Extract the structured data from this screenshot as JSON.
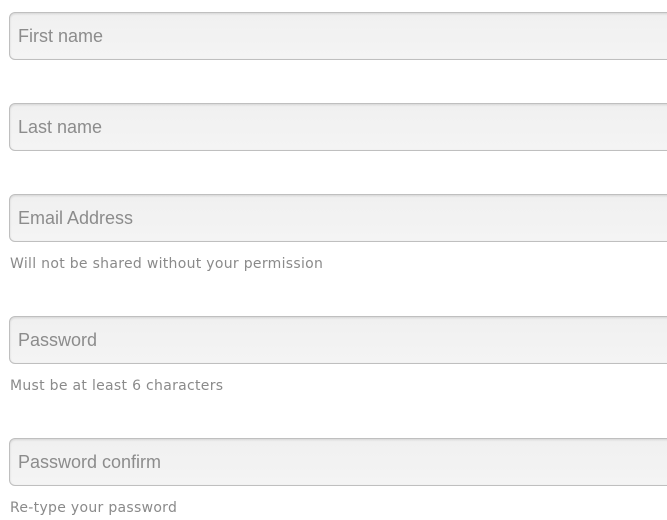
{
  "form": {
    "fields": [
      {
        "placeholder": "First name",
        "value": "",
        "hint": ""
      },
      {
        "placeholder": "Last name",
        "value": "",
        "hint": ""
      },
      {
        "placeholder": "Email Address",
        "value": "",
        "hint": "Will not be shared without your permission"
      },
      {
        "placeholder": "Password",
        "value": "",
        "hint": "Must be at least 6 characters"
      },
      {
        "placeholder": "Password confirm",
        "value": "",
        "hint": "Re-type your password"
      }
    ]
  }
}
